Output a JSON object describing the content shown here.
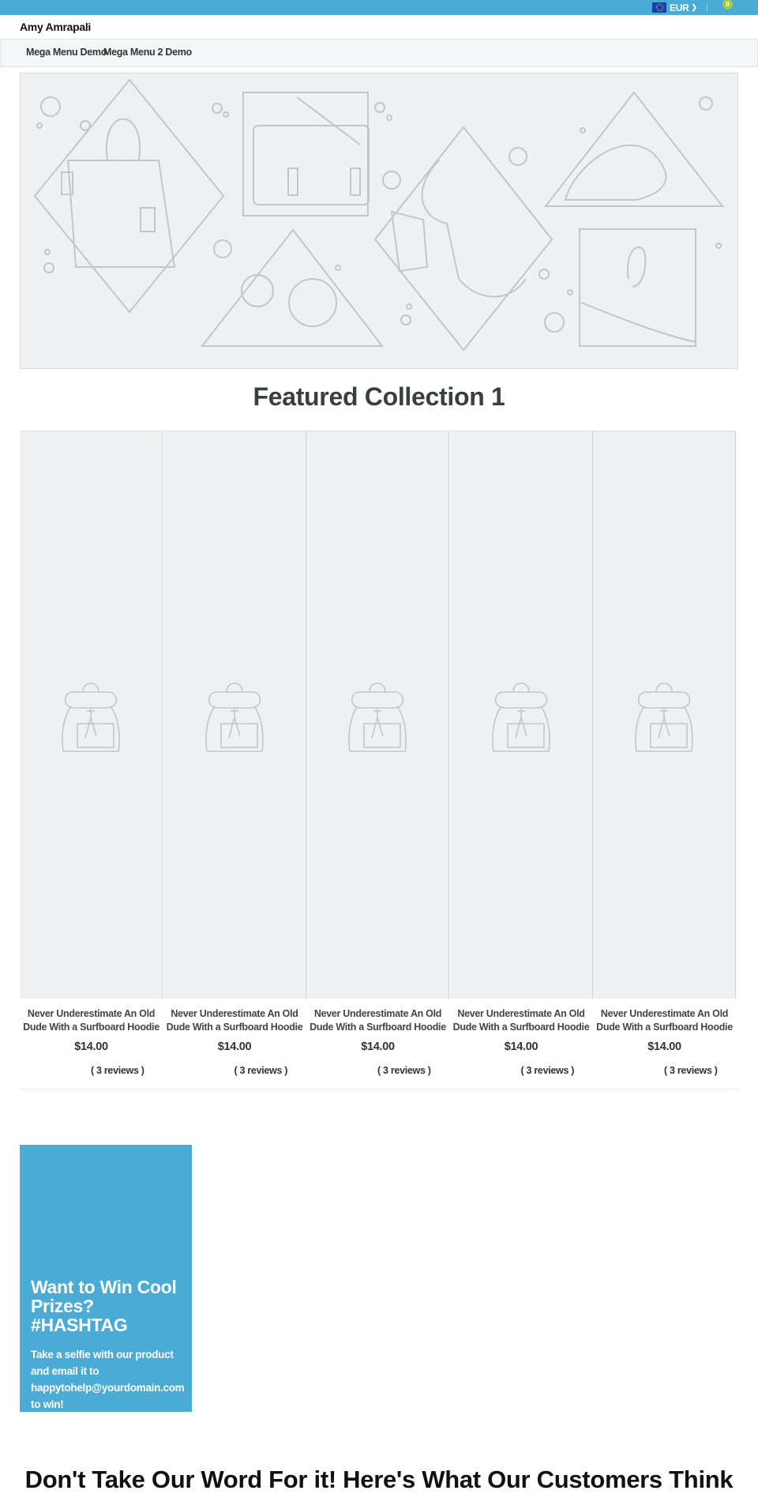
{
  "topbar": {
    "currency_label": "EUR",
    "flag_icon": "eu-flag-icon",
    "cart_count": "0",
    "accent_color": "#4aabd5",
    "badge_color": "#a6ce39"
  },
  "header": {
    "brand": "Amy Amrapali"
  },
  "nav": {
    "items": [
      {
        "label": "Mega Menu Demo"
      },
      {
        "label": "Mega Menu 2 Demo"
      }
    ]
  },
  "hero": {
    "image_icon": "hero-illustration-placeholder"
  },
  "featured": {
    "title": "Featured Collection 1",
    "products": [
      {
        "title": "Never Underestimate An Old Dude With a Surfboard Hoodie",
        "price": "$14.00",
        "reviews": "( 3 reviews )"
      },
      {
        "title": "Never Underestimate An Old Dude With a Surfboard Hoodie",
        "price": "$14.00",
        "reviews": "( 3 reviews )"
      },
      {
        "title": "Never Underestimate An Old Dude With a Surfboard Hoodie",
        "price": "$14.00",
        "reviews": "( 3 reviews )"
      },
      {
        "title": "Never Underestimate An Old Dude With a Surfboard Hoodie",
        "price": "$14.00",
        "reviews": "( 3 reviews )"
      },
      {
        "title": "Never Underestimate An Old Dude With a Surfboard Hoodie",
        "price": "$14.00",
        "reviews": "( 3 reviews )"
      }
    ]
  },
  "promo": {
    "heading_line1": "Want to Win Cool Prizes?",
    "heading_line2": "#HASHTAG",
    "body": "Take a selfie with our product and email it to happytohelp@yourdomain.com to win!"
  },
  "testimonials": {
    "title": "Don't Take Our Word For it! Here's What Our Customers Think"
  }
}
